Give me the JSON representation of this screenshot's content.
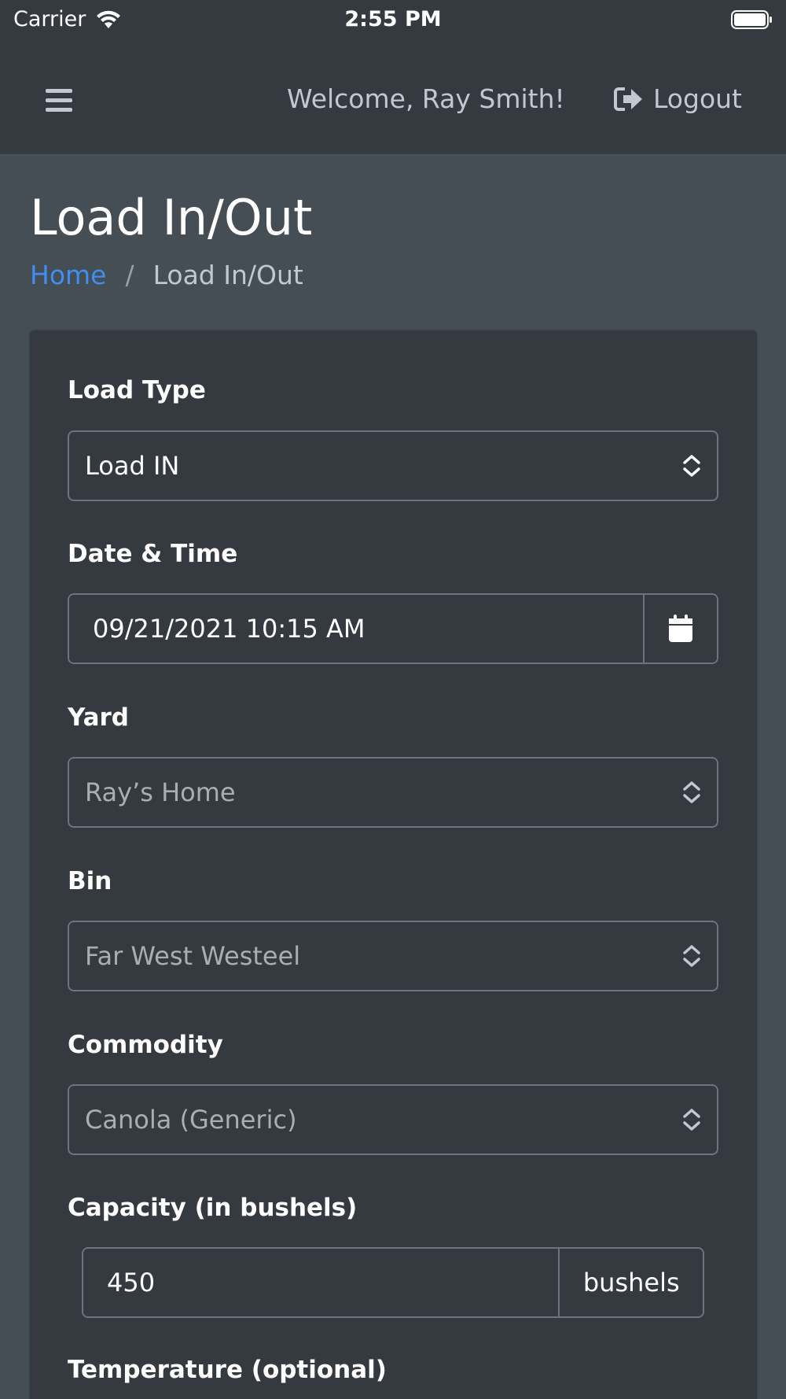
{
  "status_bar": {
    "carrier": "Carrier",
    "time": "2:55 PM"
  },
  "navbar": {
    "welcome": "Welcome, Ray Smith!",
    "logout_label": "Logout"
  },
  "header": {
    "title": "Load In/Out",
    "breadcrumb": {
      "home": "Home",
      "separator": "/",
      "current": "Load In/Out"
    }
  },
  "form": {
    "load_type": {
      "label": "Load Type",
      "value": "Load IN"
    },
    "date_time": {
      "label": "Date & Time",
      "value": "09/21/2021 10:15 AM"
    },
    "yard": {
      "label": "Yard",
      "value": "Ray’s Home"
    },
    "bin": {
      "label": "Bin",
      "value": "Far West Westeel"
    },
    "commodity": {
      "label": "Commodity",
      "value": "Canola (Generic)"
    },
    "capacity": {
      "label": "Capacity (in bushels)",
      "value": "450",
      "unit": "bushels"
    },
    "temperature": {
      "label": "Temperature (optional)"
    }
  },
  "colors": {
    "navbar_bg": "#343a40",
    "page_bg": "#454d55",
    "link": "#3f8ef0"
  }
}
